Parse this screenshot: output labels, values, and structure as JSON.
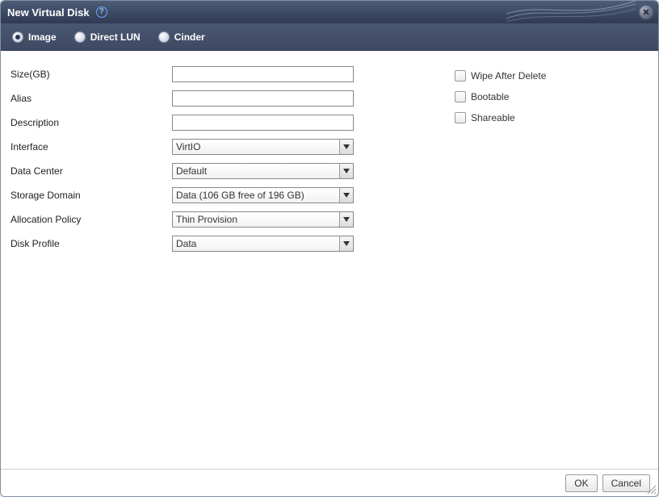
{
  "dialog": {
    "title": "New Virtual Disk"
  },
  "tabs": {
    "image": "Image",
    "direct_lun": "Direct LUN",
    "cinder": "Cinder",
    "selected": "image"
  },
  "form": {
    "size_label": "Size(GB)",
    "size_value": "",
    "alias_label": "Alias",
    "alias_value": "",
    "description_label": "Description",
    "description_value": "",
    "interface_label": "Interface",
    "interface_value": "VirtIO",
    "data_center_label": "Data Center",
    "data_center_value": "Default",
    "storage_domain_label": "Storage Domain",
    "storage_domain_value": "Data (106 GB free of 196 GB)",
    "allocation_policy_label": "Allocation Policy",
    "allocation_policy_value": "Thin Provision",
    "disk_profile_label": "Disk Profile",
    "disk_profile_value": "Data"
  },
  "options": {
    "wipe_after_delete_label": "Wipe After Delete",
    "wipe_after_delete_checked": false,
    "bootable_label": "Bootable",
    "bootable_checked": false,
    "shareable_label": "Shareable",
    "shareable_checked": false
  },
  "buttons": {
    "ok": "OK",
    "cancel": "Cancel"
  }
}
